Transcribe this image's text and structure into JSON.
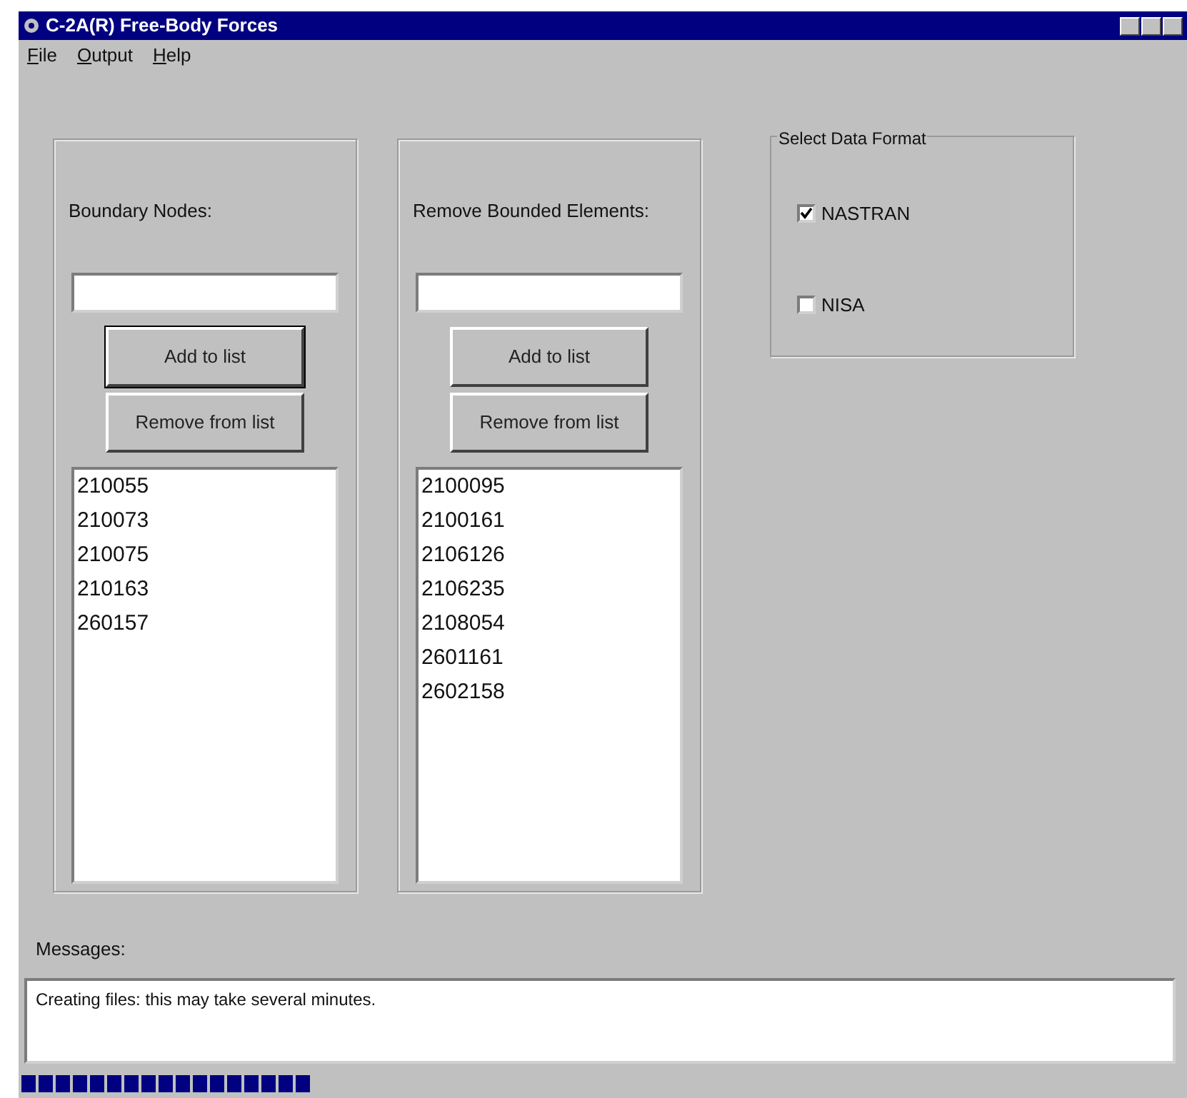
{
  "window": {
    "title": "C-2A(R) Free-Body  Forces"
  },
  "menu": [
    "File",
    "Output",
    "Help"
  ],
  "panels": [
    {
      "label": "Boundary Nodes:",
      "buttons": [
        {
          "label": "Add to list",
          "focused": true
        },
        {
          "label": "Remove from list",
          "focused": false
        }
      ],
      "items": [
        "210055",
        "210073",
        "210075",
        "210163",
        "260157"
      ]
    },
    {
      "label": "Remove Bounded Elements:",
      "buttons": [
        {
          "label": "Add to list",
          "focused": false
        },
        {
          "label": "Remove from list",
          "focused": false
        }
      ],
      "items": [
        "2100095",
        "2100161",
        "2106126",
        "2106235",
        "2108054",
        "2601161",
        "2602158"
      ]
    }
  ],
  "format": {
    "title": "Select Data Format",
    "options": [
      {
        "label": "NASTRAN",
        "checked": true
      },
      {
        "label": "NISA",
        "checked": false
      }
    ]
  },
  "messages": {
    "label": "Messages:",
    "text": "Creating files: this may take several minutes."
  },
  "progress": {
    "level": 0.25
  }
}
